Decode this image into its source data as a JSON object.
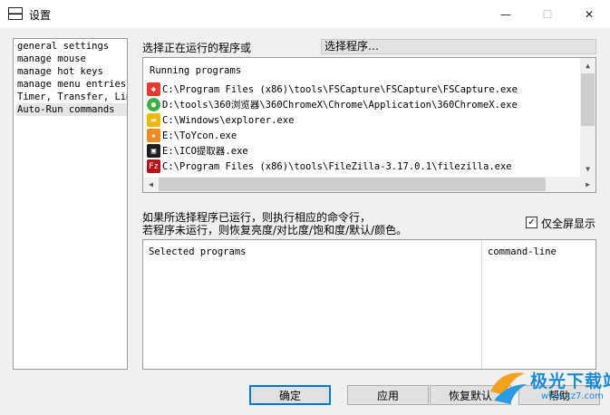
{
  "window": {
    "title": "设置"
  },
  "title_buttons": {
    "minimize": "—",
    "maximize": "☐",
    "close": "✕"
  },
  "sidebar": {
    "items": [
      {
        "label": "general settings"
      },
      {
        "label": "manage mouse"
      },
      {
        "label": "manage hot keys"
      },
      {
        "label": "manage menu entries"
      },
      {
        "label": "Timer, Transfer, Lim:"
      },
      {
        "label": "Auto-Run commands",
        "selected": true
      }
    ]
  },
  "running_section": {
    "label": "选择正在运行的程序或",
    "select_button": "选择程序…",
    "header": "Running programs",
    "programs": [
      {
        "path": "C:\\Program Files (x86)\\tools\\FSCapture\\FSCapture\\FSCapture.exe",
        "icon": "fscapture-icon",
        "color": "#e63b2e"
      },
      {
        "path": "D:\\tools\\360浏览器\\360ChromeX\\Chrome\\Application\\360ChromeX.exe",
        "icon": "360chrome-icon",
        "color": "#3cb043"
      },
      {
        "path": "C:\\Windows\\explorer.exe",
        "icon": "folder-icon",
        "color": "#f2b705"
      },
      {
        "path": "E:\\ToYcon.exe",
        "icon": "toycon-icon",
        "color": "#f08a24"
      },
      {
        "path": "E:\\ICO提取器.exe",
        "icon": "ico-extractor-icon",
        "color": "#1e1e1e"
      },
      {
        "path": "C:\\Program Files (x86)\\tools\\FileZilla-3.17.0.1\\filezilla.exe",
        "icon": "filezilla-icon",
        "color": "#b5121b"
      }
    ],
    "scroll": {
      "up": "▲",
      "down": "▼",
      "left": "◀",
      "right": "▶"
    }
  },
  "info": {
    "line1": "如果所选择程序已运行，则执行相应的命令行，",
    "line2": "若程序未运行，则恢复亮度/对比度/饱和度/默认/颜色。",
    "fullscreen_checkbox": {
      "label": "仅全屏显示",
      "checked": true,
      "mark": "✓"
    }
  },
  "selected_table": {
    "columns": [
      "Selected programs",
      "command-line"
    ]
  },
  "buttons": {
    "ok": "确定",
    "apply": "应用",
    "reset": "恢复默认",
    "help": "帮助"
  },
  "watermark": {
    "name": "极光下载站",
    "url": "www.xz7.com"
  }
}
